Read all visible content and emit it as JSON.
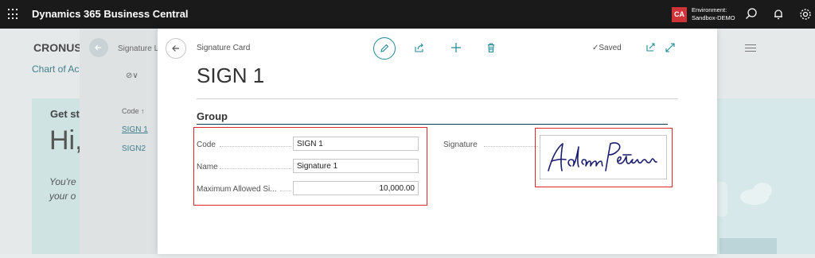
{
  "topbar": {
    "product_name": "Dynamics 365 Business Central",
    "env_initials": "CA",
    "env_line1": "Environment:",
    "env_line2": "Sandbox-DEMO"
  },
  "background": {
    "company": "CRONUS",
    "link": "Chart of Ac",
    "get_started": "Get st",
    "greeting": "Hi,",
    "intro_line1": "You're",
    "intro_line2": "your o"
  },
  "list_page": {
    "title": "Signature L",
    "filter": "⊘∨",
    "column_header": "Code ↑",
    "rows": [
      "SIGN 1",
      "SIGN2"
    ]
  },
  "card": {
    "type_label": "Signature Card",
    "title": "SIGN 1",
    "status": "✓Saved",
    "group_title": "Group",
    "fields": [
      {
        "label": "Code",
        "value": "SIGN 1"
      },
      {
        "label": "Name",
        "value": "Signature 1"
      },
      {
        "label": "Maximum Allowed Si...",
        "value": "10,000.00"
      }
    ],
    "signature_label": "Signature",
    "signature_text": "Adam Peterson"
  },
  "colors": {
    "accent": "#1e8a95",
    "highlight": "#e2262b",
    "topbar": "#1a1a1a",
    "env_badge": "#d13438"
  }
}
